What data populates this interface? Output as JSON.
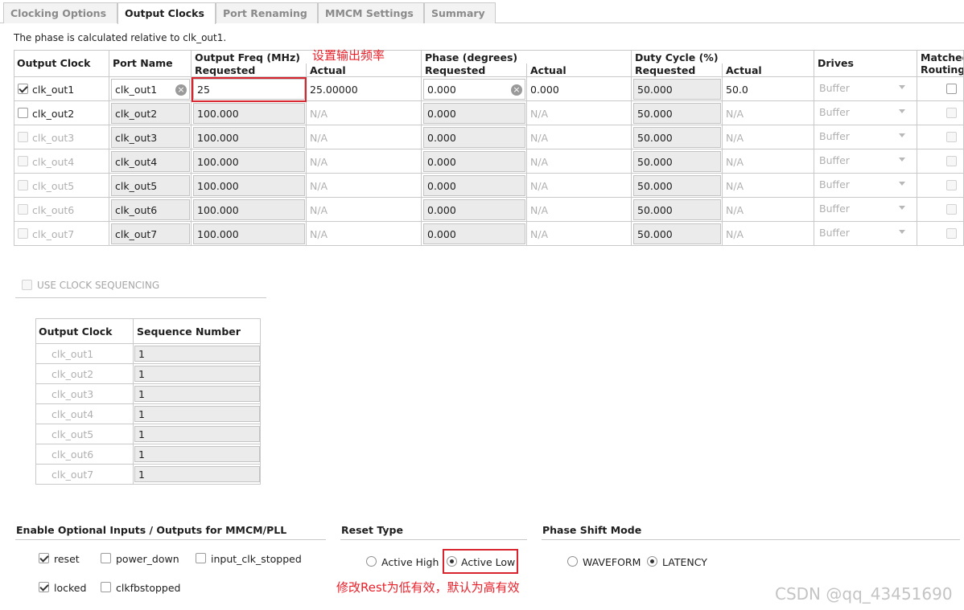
{
  "tabs": [
    "Clocking Options",
    "Output Clocks",
    "Port Renaming",
    "MMCM Settings",
    "Summary"
  ],
  "active_tab": "Output Clocks",
  "phase_note": "The phase is calculated relative to clk_out1.",
  "headers": {
    "output_clock": "Output Clock",
    "port_name": "Port Name",
    "output_freq": "Output Freq (MHz)",
    "phase": "Phase (degrees)",
    "duty_cycle": "Duty Cycle (%)",
    "requested": "Requested",
    "actual": "Actual",
    "drives": "Drives",
    "matched_routing": "Matched Routing"
  },
  "annotation_freq": "设置输出频率",
  "rows": [
    {
      "name": "clk_out1",
      "port": "clk_out1",
      "freq_req": "25",
      "freq_act": "25.00000",
      "phase_req": "0.000",
      "phase_act": "0.000",
      "duty_req": "50.000",
      "duty_act": "50.0",
      "drives": "Buffer",
      "checked": true,
      "enabled": true
    },
    {
      "name": "clk_out2",
      "port": "clk_out2",
      "freq_req": "100.000",
      "freq_act": "N/A",
      "phase_req": "0.000",
      "phase_act": "N/A",
      "duty_req": "50.000",
      "duty_act": "N/A",
      "drives": "Buffer",
      "checked": false,
      "enabled": true
    },
    {
      "name": "clk_out3",
      "port": "clk_out3",
      "freq_req": "100.000",
      "freq_act": "N/A",
      "phase_req": "0.000",
      "phase_act": "N/A",
      "duty_req": "50.000",
      "duty_act": "N/A",
      "drives": "Buffer",
      "checked": false,
      "enabled": false
    },
    {
      "name": "clk_out4",
      "port": "clk_out4",
      "freq_req": "100.000",
      "freq_act": "N/A",
      "phase_req": "0.000",
      "phase_act": "N/A",
      "duty_req": "50.000",
      "duty_act": "N/A",
      "drives": "Buffer",
      "checked": false,
      "enabled": false
    },
    {
      "name": "clk_out5",
      "port": "clk_out5",
      "freq_req": "100.000",
      "freq_act": "N/A",
      "phase_req": "0.000",
      "phase_act": "N/A",
      "duty_req": "50.000",
      "duty_act": "N/A",
      "drives": "Buffer",
      "checked": false,
      "enabled": false
    },
    {
      "name": "clk_out6",
      "port": "clk_out6",
      "freq_req": "100.000",
      "freq_act": "N/A",
      "phase_req": "0.000",
      "phase_act": "N/A",
      "duty_req": "50.000",
      "duty_act": "N/A",
      "drives": "Buffer",
      "checked": false,
      "enabled": false
    },
    {
      "name": "clk_out7",
      "port": "clk_out7",
      "freq_req": "100.000",
      "freq_act": "N/A",
      "phase_req": "0.000",
      "phase_act": "N/A",
      "duty_req": "50.000",
      "duty_act": "N/A",
      "drives": "Buffer",
      "checked": false,
      "enabled": false
    }
  ],
  "sequencing": {
    "label": "USE CLOCK SEQUENCING",
    "col_clock": "Output Clock",
    "col_seq": "Sequence Number",
    "rows": [
      {
        "clock": "clk_out1",
        "seq": "1"
      },
      {
        "clock": "clk_out2",
        "seq": "1"
      },
      {
        "clock": "clk_out3",
        "seq": "1"
      },
      {
        "clock": "clk_out4",
        "seq": "1"
      },
      {
        "clock": "clk_out5",
        "seq": "1"
      },
      {
        "clock": "clk_out6",
        "seq": "1"
      },
      {
        "clock": "clk_out7",
        "seq": "1"
      }
    ]
  },
  "optional": {
    "title": "Enable Optional Inputs / Outputs for MMCM/PLL",
    "reset": "reset",
    "power_down": "power_down",
    "input_clk_stopped": "input_clk_stopped",
    "locked": "locked",
    "clkfbstopped": "clkfbstopped"
  },
  "reset_type": {
    "title": "Reset Type",
    "active_high": "Active High",
    "active_low": "Active Low",
    "selected": "Active Low"
  },
  "phase_shift": {
    "title": "Phase Shift Mode",
    "waveform": "WAVEFORM",
    "latency": "LATENCY",
    "selected": "LATENCY"
  },
  "annotation_reset": "修改Rest为低有效，默认为高有效",
  "watermark": "CSDN @qq_43451690",
  "colors": {
    "annotation": "#e8202a",
    "disabled_text": "#b0b0b0"
  }
}
